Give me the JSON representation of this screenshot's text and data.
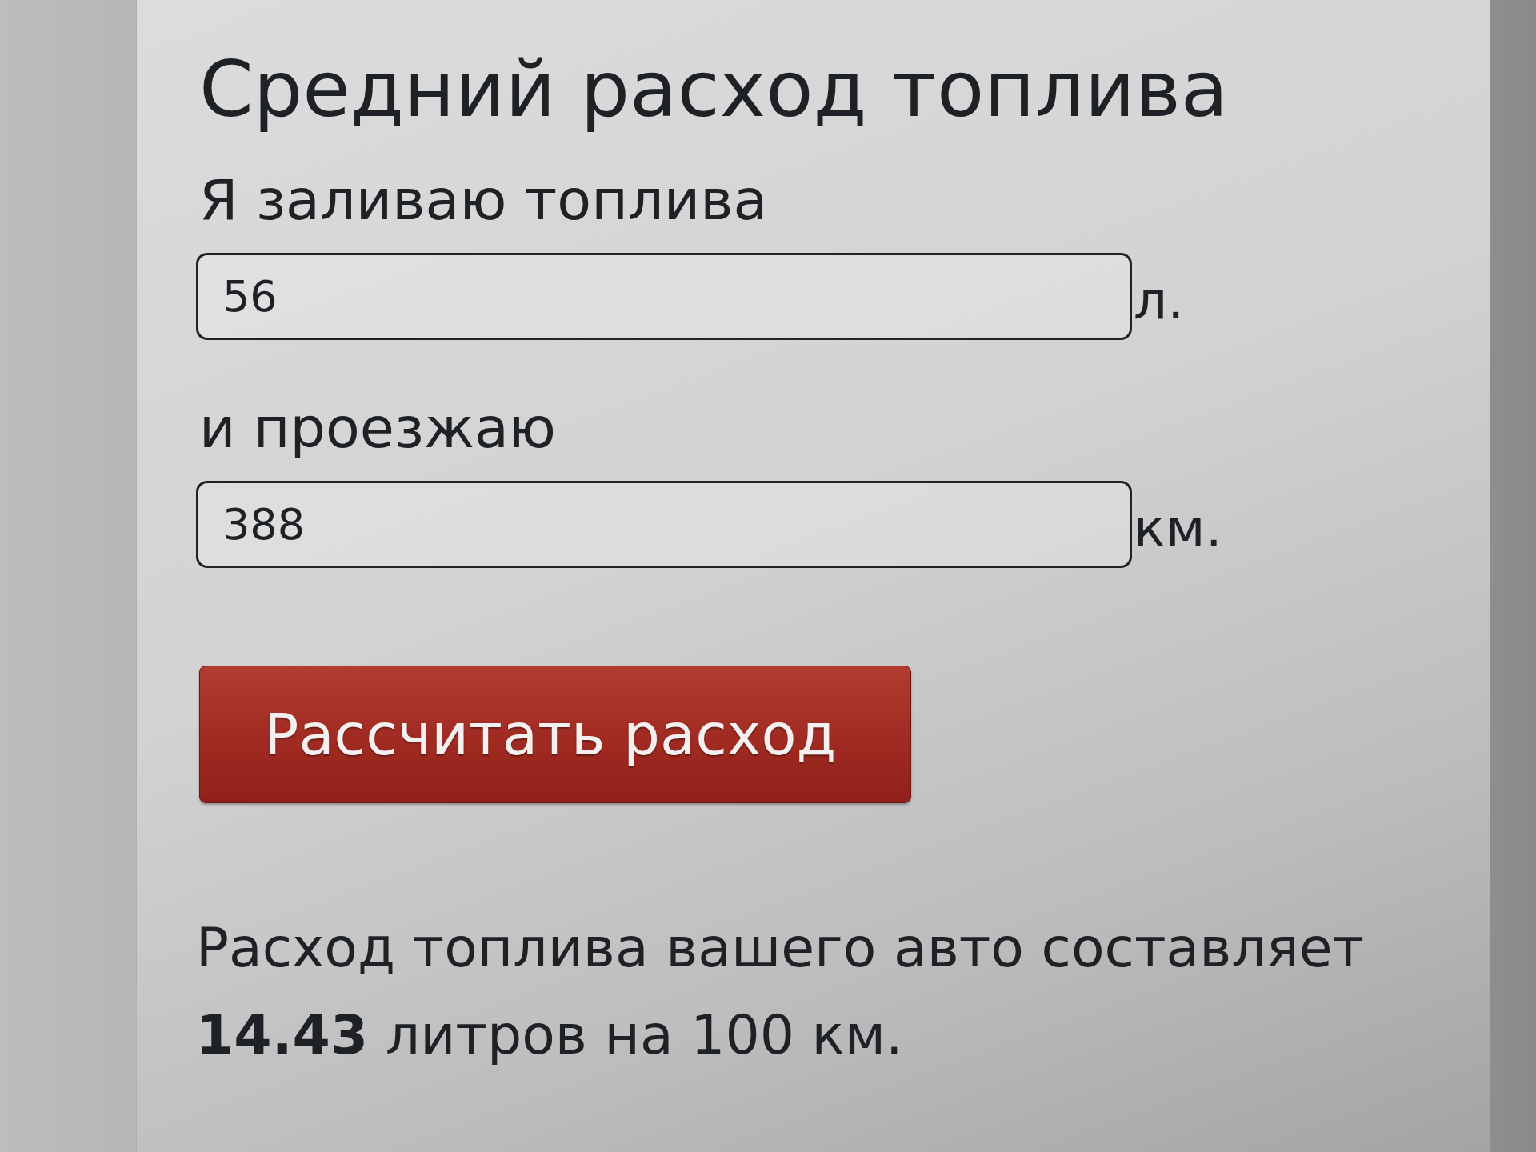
{
  "title": "Средний расход топлива",
  "fields": [
    {
      "label": "Я заливаю топлива",
      "value": "56",
      "unit": "л."
    },
    {
      "label": "и проезжаю",
      "value": "388",
      "unit": "км."
    }
  ],
  "button": "Рассчитать расход",
  "result": "Расход топлива вашего авто составляет **14.43** литров на 100 км."
}
